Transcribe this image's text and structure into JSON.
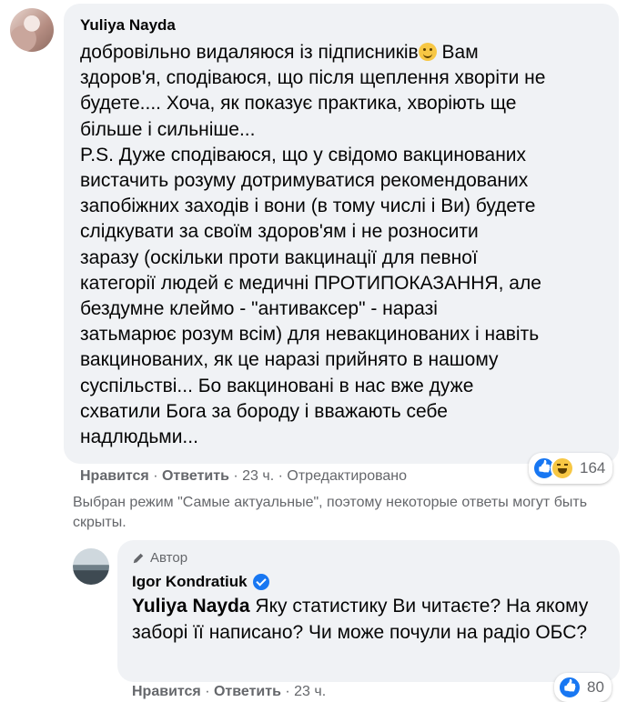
{
  "comment": {
    "author": "Yuliya Nayda",
    "line1_text": "добровільно видаляюся із підписників",
    "line1_after": " Вам",
    "body_rest": "здоров'я, сподіваюся, що після щеплення хворіти не\nбудете.... Хоча, як показує практика, хворіють ще\nбільше і сильніше...\nP.S. Дуже сподіваюся, що у свідомо вакцинованих\nвистачить розуму дотримуватися рекомендованих\nзапобіжних заходів і вони (в тому числі і Ви) будете\nслідкувати за своїм здоров'ям і не розносити\nзаразу (оскільки проти вакцинації для певної\nкатегорії людей є медичні ПРОТИПОКАЗАННЯ, але\nбездумне клеймо - \"антиваксер\" - наразі\nзатьмарює розум всім) для невакцинованих і навіть\nвакцинованих, як це наразі прийнято в нашому\nсуспільстві... Бо вакциновані в нас вже дуже\nсхватили Бога за бороду і вважають себе\nнадлюдьми...",
    "emoji": "winking-face-emoji",
    "like_label": "Нравится",
    "reply_label": "Ответить",
    "sep": " · ",
    "time": "23 ч.",
    "edited": "Отредактировано",
    "reaction_count": "164"
  },
  "notice": "Выбран режим \"Самые актуальные\", поэтому некоторые ответы могут быть скрыты.",
  "reply": {
    "badge": "Автор",
    "author": "Igor Kondratiuk",
    "mention": "Yuliya Nayda",
    "text": " Яку статистику Ви читаєте? На якому заборі її написано? Чи може почули на радіо ОБС?",
    "like_label": "Нравится",
    "reply_label": "Ответить",
    "sep": " · ",
    "time": "23 ч.",
    "reaction_count": "80"
  },
  "colors": {
    "bubble": "#f0f2f5",
    "secondary_text": "#65676b",
    "like_blue": "#1877f2",
    "haha_yellow": "#f7c744"
  }
}
